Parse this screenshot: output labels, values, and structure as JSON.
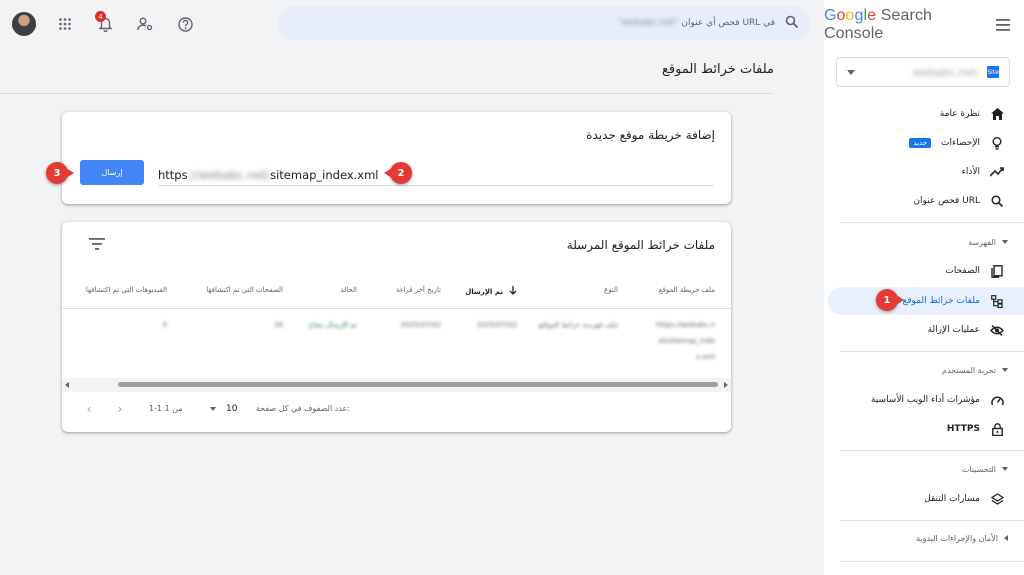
{
  "app": {
    "brand_google": "Google",
    "brand_product": "Search Console",
    "property_name": "webabc.net",
    "property_badge": "Site"
  },
  "search": {
    "prefix": "فحص أي عنوان URL في",
    "domain": "\"webabc.net\""
  },
  "topbar": {
    "notification_count": "4"
  },
  "sidebar": {
    "items": [
      {
        "label": "نظرة عامة",
        "icon": "home-icon"
      },
      {
        "label": "الإحصاءات",
        "icon": "lightbulb-icon",
        "badge": "جديد"
      },
      {
        "label": "الأداء",
        "icon": "trending-up-icon"
      },
      {
        "label": "فحص عنوان URL",
        "icon": "search-icon"
      }
    ],
    "section_indexing": "الفهرسة",
    "indexing_items": [
      {
        "label": "الصفحات",
        "icon": "pages-icon"
      },
      {
        "label": "ملفات خرائط الموقع",
        "icon": "sitemap-icon"
      },
      {
        "label": "عمليات الإزالة",
        "icon": "visibility-off-icon"
      }
    ],
    "section_experience": "تجربة المستخدم",
    "experience_items": [
      {
        "label": "مؤشرات أداء الويب الأساسية",
        "icon": "speed-icon"
      },
      {
        "label": "HTTPS",
        "icon": "lock-icon"
      }
    ],
    "section_enhancements": "التحسينات",
    "enhancement_items": [
      {
        "label": "مسارات التنقل",
        "icon": "layers-icon"
      }
    ],
    "section_security": "الأمان والإجراءات اليدوية"
  },
  "page": {
    "title": "ملفات خرائط الموقع"
  },
  "add_card": {
    "title": "إضافة خريطة موقع جديدة",
    "url_prefix": "https",
    "url_domain": "://webabc.net/",
    "url_path": "sitemap_index.xml",
    "submit_label": "إرسال"
  },
  "submitted_card": {
    "title": "ملفات خرائط الموقع المرسلة",
    "columns": [
      "ملف خريطة الموقع",
      "النوع",
      "تم الإرسال",
      "تاريخ آخر قراءة",
      "الحالة",
      "الصفحات التي تم اكتشافها",
      "الفيديوهات التي تم اكتشافها"
    ],
    "row": {
      "sitemap_l1": "https://webabc.n",
      "sitemap_l2": "et/sitemap_inde",
      "sitemap_l3": "x.xml",
      "type": "ملف فهرسة خرائط المواقع",
      "submitted": "2025/07/02",
      "last_read": "2025/07/02",
      "status": "تم الإرسال بنجاح",
      "pages": "16",
      "videos": "0"
    },
    "rows_per_page_label": "عدد الصفوف في كل صفحة:",
    "rows_per_page": "10",
    "range": "1-1 من 1"
  },
  "callouts": [
    "1",
    "2",
    "3"
  ]
}
